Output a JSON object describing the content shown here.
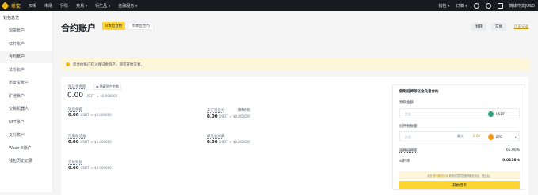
{
  "topbar": {
    "logo": "币安",
    "nav": [
      "买币",
      "市场",
      "行情",
      "交易 ▾",
      "衍生品 ▾",
      "金融服务 ▾"
    ],
    "right": [
      "钱包 ▾",
      "订单 ▾",
      "简体中文|USD"
    ]
  },
  "sidebar": {
    "items": [
      "钱包总览",
      "现货账户",
      "杠杆账户",
      "合约账户",
      "法币账户",
      "币安宝账户",
      "矿池账户",
      "交易机器人",
      "NFT账户",
      "支付账户",
      "Wazir X账户",
      "钱包历史记录"
    ]
  },
  "header": {
    "title": "合约账户",
    "tabs": [
      "U本位合约",
      "币本位合约"
    ],
    "buttons": [
      "划转",
      "交易"
    ],
    "link": "历史记录"
  },
  "notice": "您合约账户转入保证金资产，即可开始交易。",
  "balance": {
    "label": "保证金余额",
    "hide_label": "隐藏资产余额",
    "value": "0.00",
    "unit": "USDT",
    "approx": "≈ $0.000000"
  },
  "metrics": {
    "wallet": {
      "label": "钱包余额",
      "value": "0.00",
      "unit": "USDT",
      "approx": "≈ $0.000000"
    },
    "unrealized": {
      "label": "未实现盈亏",
      "value": "0.00",
      "unit": "USDT",
      "approx": "≈ $0.000000",
      "badge": "查看仓位"
    },
    "available": {
      "label": "可用保证金",
      "value": "0.00",
      "unit": "USDT",
      "approx": "≈ $0.000000"
    },
    "bonus": {
      "label": "交易奖励",
      "value": "0.00",
      "unit": "USDT",
      "approx": "≈ $0.000000"
    },
    "margin_used": {
      "label": "保证金余额",
      "value": "0.00",
      "unit": "USDT",
      "approx": "≈ $0.000000"
    }
  },
  "calc": {
    "title": "使用抵押保证金交易合约",
    "field1_label": "预期金额",
    "field1_placeholder": "数量",
    "field1_currency": "USDT",
    "field2_label": "抵押物数量",
    "field2_placeholder": "数量",
    "field2_max": "最大",
    "field2_max_val": "0.00",
    "field2_currency": "BTC",
    "rate_label": "质押抵押率",
    "rate_value": "65.00%",
    "daily_label": "日利率",
    "daily_value": "0.0216%",
    "disclaimer_pre": "点击",
    "disclaimer_link": "借币服务协议",
    "disclaimer_post": "即表示您同意借币服务协议，在此后。",
    "button": "开始借币"
  },
  "colors": {
    "accent": "#fcd535",
    "topbar": "#181a20",
    "usdt": "#26a17b",
    "btc": "#f7931a"
  }
}
